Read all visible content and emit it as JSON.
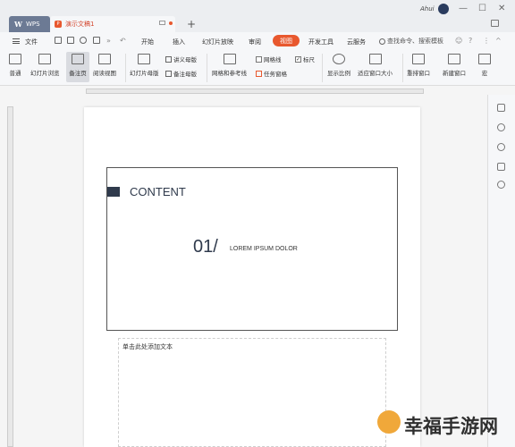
{
  "window": {
    "wps_tab": "WPS",
    "doc_tab": "演示文稿1",
    "user_name": "Ahui"
  },
  "menu": {
    "file": "文件",
    "tabs": [
      "开始",
      "插入",
      "幻灯片放映",
      "审阅",
      "视图",
      "开发工具",
      "云服务"
    ],
    "active_tab": "视图",
    "search_text": "查找命令、搜索模板"
  },
  "ribbon": {
    "normal": "普通",
    "slide_browse": "幻灯片浏览",
    "notes_page": "备注页",
    "reading_view": "阅读视图",
    "slide_master": "幻灯片母版",
    "handout_master": "讲义母版",
    "notes_master": "备注母版",
    "grid_guides": "网格和参考线",
    "gridlines": "网格线",
    "ruler": "标尺",
    "task_pane": "任务窗格",
    "zoom": "显示比例",
    "fit_window": "适应窗口大小",
    "arrange_window": "重排窗口",
    "new_window": "新建窗口",
    "macro": "宏"
  },
  "slide": {
    "content_title": "CONTENT",
    "number": "01/",
    "subtitle": "LOREM IPSUM DOLOR"
  },
  "notes": {
    "placeholder": "单击此处添加文本"
  },
  "watermark": {
    "text": "幸福手游网"
  },
  "colors": {
    "accent": "#e8582e",
    "slide_dark": "#2f3a4c"
  }
}
